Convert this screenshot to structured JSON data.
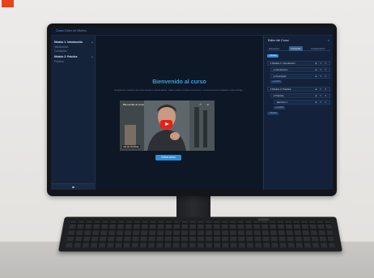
{
  "app": {
    "brand": "Curso",
    "title_rest": "Editor de Niveles"
  },
  "sidebar": {
    "items": [
      {
        "label": "Módulo 1: Introducción",
        "type": "head"
      },
      {
        "label": "Introducción",
        "type": "sub"
      },
      {
        "label": "Conceptos",
        "type": "sub"
      },
      {
        "label": "Módulo 2: Práctica",
        "type": "head"
      },
      {
        "label": "Práctica",
        "type": "sub"
      }
    ]
  },
  "main": {
    "welcome": "Bienvenido al curso",
    "description": "Explora los módulos del curso desde el panel lateral. Cada módulo contiene lecciones y recursos para completar tu aprendizaje.",
    "video": {
      "title": "Bienvenido al curso",
      "bottom_label": "Ver en YouTube"
    },
    "cta_label": "Iniciar curso"
  },
  "panel": {
    "title": "Editor del Curso",
    "close_glyph": "×",
    "tabs": [
      "Estructura",
      "Contenido",
      "Configuración"
    ],
    "active_tab": 1,
    "new_button": "+ Nuevo",
    "rows": [
      {
        "label": "▾ Módulo 1: Introducción",
        "level": 1
      },
      {
        "label": "▸ Introducción",
        "level": 2
      },
      {
        "label": "▸ Conceptos",
        "level": 2
      },
      {
        "label": "▾ Módulo 2: Práctica",
        "level": 1
      },
      {
        "label": "▾ Práctica",
        "level": 2
      },
      {
        "label": "Ejercicio 1",
        "level": 3
      }
    ],
    "add_lesson": "+ Lección",
    "add_module": "+ Módulo"
  },
  "colors": {
    "accent": "#2f8fd6",
    "play": "#e62117",
    "brand_badge": "#e8421c"
  }
}
